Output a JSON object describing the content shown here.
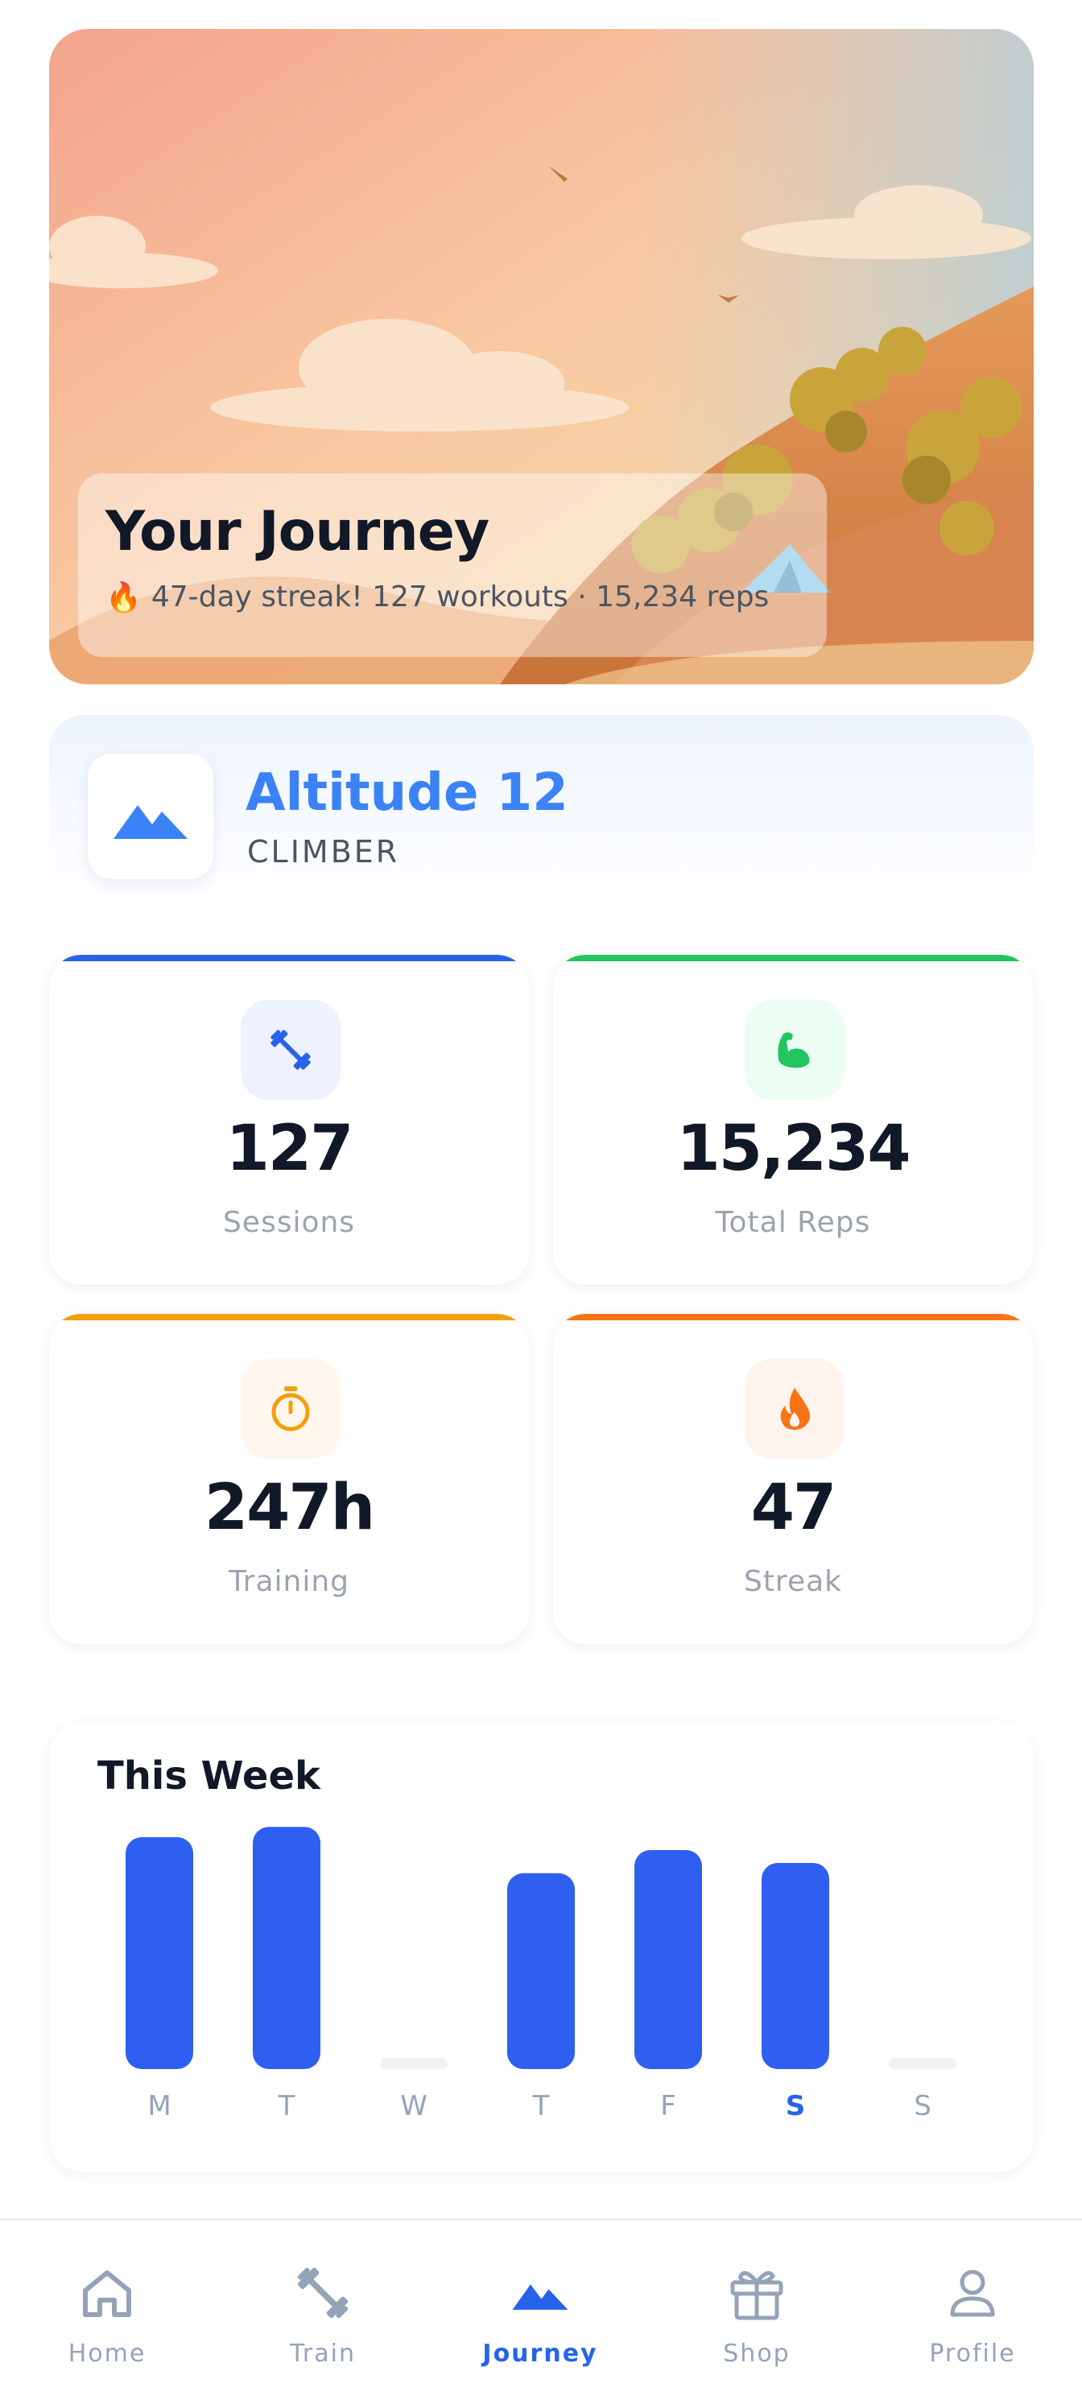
{
  "hero": {
    "title": "Your Journey",
    "subtitle": "47-day streak! 127 workouts · 15,234 reps",
    "flame_icon": "flame-icon"
  },
  "level": {
    "title": "Altitude 12",
    "rank": "CLIMBER",
    "icon": "mountain-icon",
    "accent": "#3b82f6"
  },
  "stats": [
    {
      "value": "127",
      "label": "Sessions",
      "icon": "dumbbell-icon",
      "accent": "#2563eb",
      "soft": "#eef2ff"
    },
    {
      "value": "15,234",
      "label": "Total Reps",
      "icon": "muscle-icon",
      "accent": "#22c55e",
      "soft": "#ecfdf3"
    },
    {
      "value": "247h",
      "label": "Training",
      "icon": "stopwatch-icon",
      "accent": "#f59e0b",
      "soft": "#fff7ed"
    },
    {
      "value": "47",
      "label": "Streak",
      "icon": "flame-icon",
      "accent": "#f97316",
      "soft": "#fff4ed"
    }
  ],
  "week": {
    "title": "This Week",
    "chart_data": {
      "type": "bar",
      "categories": [
        "M",
        "T",
        "W",
        "T",
        "F",
        "S",
        "S"
      ],
      "values": [
        0.9,
        0.94,
        0,
        0.76,
        0.85,
        0.8,
        0
      ],
      "highlight_index": 5,
      "bar_color": "#2f5ff0",
      "empty_color": "#eef1f6",
      "label_color": "#94a3b8",
      "highlight_label_color": "#2563eb"
    }
  },
  "nav": {
    "items": [
      {
        "label": "Home",
        "icon": "home-icon",
        "active": false
      },
      {
        "label": "Train",
        "icon": "dumbbell-icon",
        "active": false
      },
      {
        "label": "Journey",
        "icon": "mountain-icon",
        "active": true
      },
      {
        "label": "Shop",
        "icon": "gift-icon",
        "active": false
      },
      {
        "label": "Profile",
        "icon": "person-icon",
        "active": false
      }
    ],
    "active_color": "#2563eb",
    "inactive_color": "#94a3b8"
  }
}
